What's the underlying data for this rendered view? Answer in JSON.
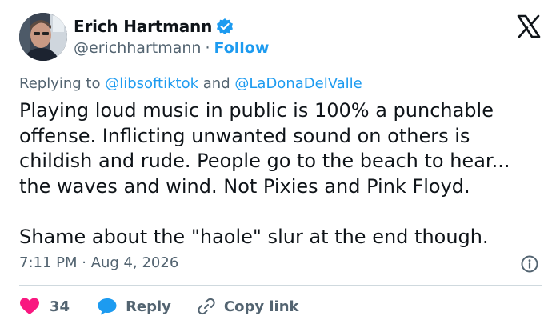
{
  "author": {
    "display_name": "Erich Hartmann",
    "handle": "@erichhartmann",
    "separator": "·",
    "follow_label": "Follow",
    "verified": true
  },
  "reply": {
    "prefix": "Replying to",
    "mention_1": "@libsoftiktok",
    "conjunction": "and",
    "mention_2": "@LaDonaDelValle"
  },
  "tweet": {
    "text": "Playing loud music in public is 100% a punchable\noffense. Inflicting unwanted sound on others is\nchildish and rude. People go to the beach to hear...\nthe waves and wind. Not Pixies and Pink Floyd.\n\nShame about the \"haole\" slur at the end though.",
    "timestamp": "7:11 PM · Aug 4, 2026"
  },
  "actions": {
    "like_count": "34",
    "reply_label": "Reply",
    "copy_link_label": "Copy link"
  },
  "colors": {
    "brand_blue": "#1d9bf0",
    "like_pink": "#f91880",
    "text_primary": "#0f1419",
    "text_secondary": "#536471",
    "divider": "#cfd9de"
  },
  "icons": [
    "verified-badge-icon",
    "x-logo-icon",
    "info-icon",
    "heart-icon",
    "reply-bubble-icon",
    "link-icon"
  ]
}
